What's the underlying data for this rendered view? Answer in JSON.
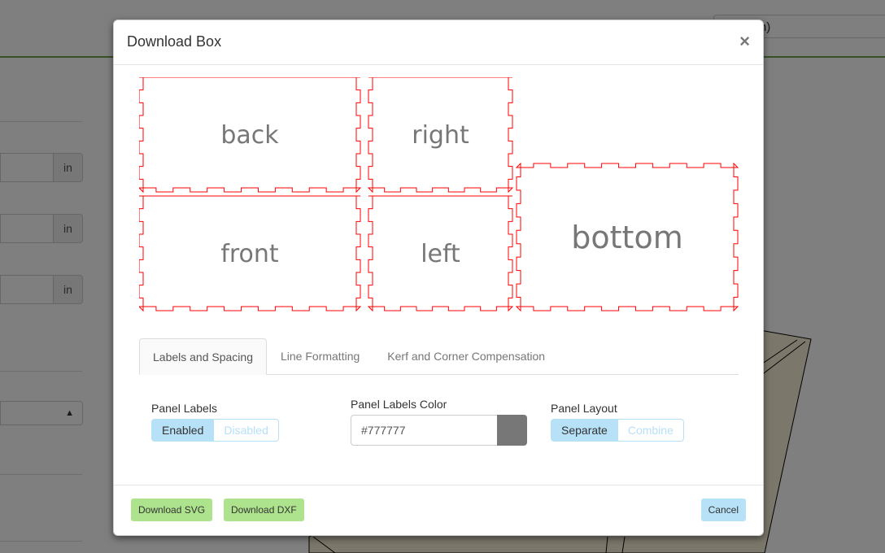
{
  "background": {
    "language_selector": "(English)",
    "unit_addons": [
      "in",
      "in",
      "in"
    ]
  },
  "modal": {
    "title": "Download Box",
    "close_label": "×",
    "preview": {
      "stroke_color": "#ff0000",
      "label_color": "#777777",
      "panels": [
        {
          "name": "back"
        },
        {
          "name": "right"
        },
        {
          "name": "front"
        },
        {
          "name": "left"
        },
        {
          "name": "bottom"
        }
      ]
    },
    "tabs": [
      {
        "label": "Labels and Spacing",
        "active": true
      },
      {
        "label": "Line Formatting",
        "active": false
      },
      {
        "label": "Kerf and Corner Compensation",
        "active": false
      }
    ],
    "settings": {
      "panel_labels": {
        "label": "Panel Labels",
        "options": [
          "Enabled",
          "Disabled"
        ],
        "selected": "Enabled"
      },
      "panel_labels_color": {
        "label": "Panel Labels Color",
        "value": "#777777",
        "swatch": "#777777"
      },
      "panel_layout": {
        "label": "Panel Layout",
        "options": [
          "Separate",
          "Combine"
        ],
        "selected": "Separate"
      }
    },
    "footer": {
      "download_svg": "Download SVG",
      "download_dxf": "Download DXF",
      "cancel": "Cancel"
    }
  }
}
